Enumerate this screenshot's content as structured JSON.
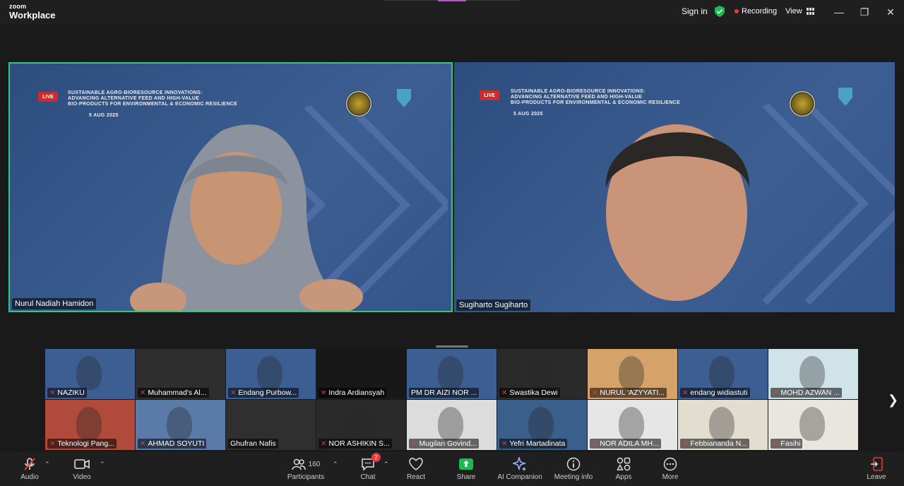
{
  "app": {
    "brand_small": "zoom",
    "brand_large": "Workplace"
  },
  "titlebar": {
    "sign_in": "Sign in",
    "recording": "Recording",
    "view": "View"
  },
  "slide": {
    "live": "LIVE",
    "line1": "SUSTAINABLE AGRO-BIORESOURCE INNOVATIONS:",
    "line2": "ADVANCING ALTERNATIVE FEED AND HIGH-VALUE",
    "line3": "BIO-PRODUCTS FOR ENVIRONMENTAL & ECONOMIC RESILIENCE",
    "date": "5 AUG 2025"
  },
  "speakers": [
    {
      "name": "Nurul Nadiah Hamidon"
    },
    {
      "name": "Sugiharto Sugiharto"
    }
  ],
  "participants_strip": [
    {
      "name": "NAZIKU",
      "muted": true
    },
    {
      "name": "Muhammad's Al...",
      "muted": true
    },
    {
      "name": "Endang Purbow...",
      "muted": true
    },
    {
      "name": "Indra Ardiansyah",
      "muted": true
    },
    {
      "name": "PM DR AIZI NOR ...",
      "muted": false
    },
    {
      "name": "Swastika Dewi",
      "muted": true
    },
    {
      "name": "NURUL 'AZYYATI...",
      "muted": true
    },
    {
      "name": "endang widiastuti",
      "muted": true
    },
    {
      "name": "MOHD AZWAN ...",
      "muted": true
    },
    {
      "name": "Teknologi Pang...",
      "muted": true
    },
    {
      "name": "AHMAD SOYUTI",
      "muted": true
    },
    {
      "name": "Ghufran Nafis",
      "muted": false
    },
    {
      "name": "NOR ASHIKIN S...",
      "muted": true
    },
    {
      "name": "Mugilan Govind...",
      "muted": true
    },
    {
      "name": "Yefri Martadinata",
      "muted": true
    },
    {
      "name": "NOR ADILA MH...",
      "muted": true
    },
    {
      "name": "Febbiananda N...",
      "muted": true
    },
    {
      "name": "Fasihi",
      "muted": true
    }
  ],
  "toolbar": {
    "audio": "Audio",
    "video": "Video",
    "participants": "Participants",
    "participants_count": "160",
    "chat": "Chat",
    "chat_badge": "2",
    "react": "React",
    "share": "Share",
    "ai_companion": "AI Companion",
    "meeting_info": "Meeting info",
    "apps": "Apps",
    "more": "More",
    "leave": "Leave"
  },
  "colors": {
    "accent_green": "#36c77a",
    "share_green": "#1db954",
    "recording_red": "#e5393b"
  }
}
